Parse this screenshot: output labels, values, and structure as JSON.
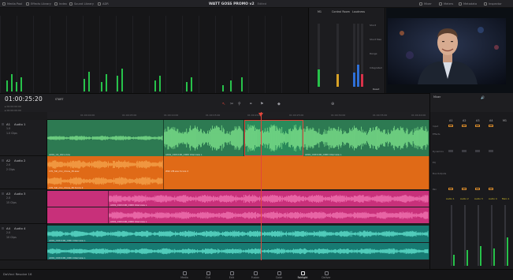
{
  "top_tabs": [
    "Media Pool",
    "Effects Library",
    "Index",
    "Sound Library",
    "ADR"
  ],
  "project": {
    "title": "WATT GOSS PROMO v2",
    "status": "Edited"
  },
  "right_tabs": [
    "Mixer",
    "Meters",
    "Metadata",
    "Inspector"
  ],
  "control_panel": {
    "sections": [
      "M1",
      "Control Room",
      "Loudness"
    ],
    "labels": [
      "Short",
      "Short Max",
      "Range",
      "Integrated"
    ],
    "reset": "Reset"
  },
  "timecode": "01:00:25:20",
  "start_menu": "START",
  "ruler_ticks": [
    "01:00:00:00",
    "01:00:05:00",
    "01:00:10:00",
    "01:00:15:00",
    "01:00:20:00",
    "01:00:25:00",
    "01:00:30:00",
    "01:00:35:00",
    "01:00:40:00"
  ],
  "tracks": [
    {
      "id": "A1",
      "name": "Audio 1",
      "ch": "1.0",
      "fx": "1.0 Clips"
    },
    {
      "id": "A2",
      "name": "Audio 2",
      "ch": "2.0",
      "fx": "2 Clips"
    },
    {
      "id": "A3",
      "name": "Audio 3",
      "ch": "2.0",
      "fx": "15 Clips"
    },
    {
      "id": "A4",
      "name": "Audio 4",
      "ch": "2.0",
      "fx": "10 Clips"
    }
  ],
  "clip_labels": {
    "a1": [
      "A001_C4_Intro.mov",
      "A001_C021100_C060 Interview L",
      "A001_C021100_C060 Interview L"
    ],
    "a2": [
      "170_full_mix_drone_30.wav",
      "170_full_mix_drone_30 Score 2",
      "Wild 2M.wav Score 2"
    ],
    "a3": [
      "A001_C021100_C060 Interview L",
      "A001_C021100_C060 Interview L"
    ],
    "a4": [
      "A001_C021100_C061 Interview L",
      "A001_C021100_C061 Interview L"
    ]
  },
  "mixer": {
    "title": "Mixer",
    "channels": [
      "A1",
      "A2",
      "A3",
      "A4",
      "M1"
    ],
    "row_labels": [
      "Input",
      "Effects",
      "Dynamics",
      "EQ",
      "Bus Outputs",
      "Pan"
    ],
    "tags": [
      "Audio 1",
      "Audio 2",
      "Audio 3",
      "Audio 4",
      "Main 1"
    ],
    "levels": [
      0.35,
      0.5,
      0.62,
      0.55,
      0.9
    ],
    "level_color": "#27c24a"
  },
  "nav": [
    "Media",
    "Cut",
    "Edit",
    "Fusion",
    "Color",
    "Fairlight",
    "Deliver"
  ],
  "nav_active": "Fairlight",
  "brand": "DaVinci Resolve 16",
  "colors": {
    "a1": "#2d7a52",
    "a2": "#e06a17",
    "a3": "#c8307a",
    "a4": "#177a72"
  }
}
